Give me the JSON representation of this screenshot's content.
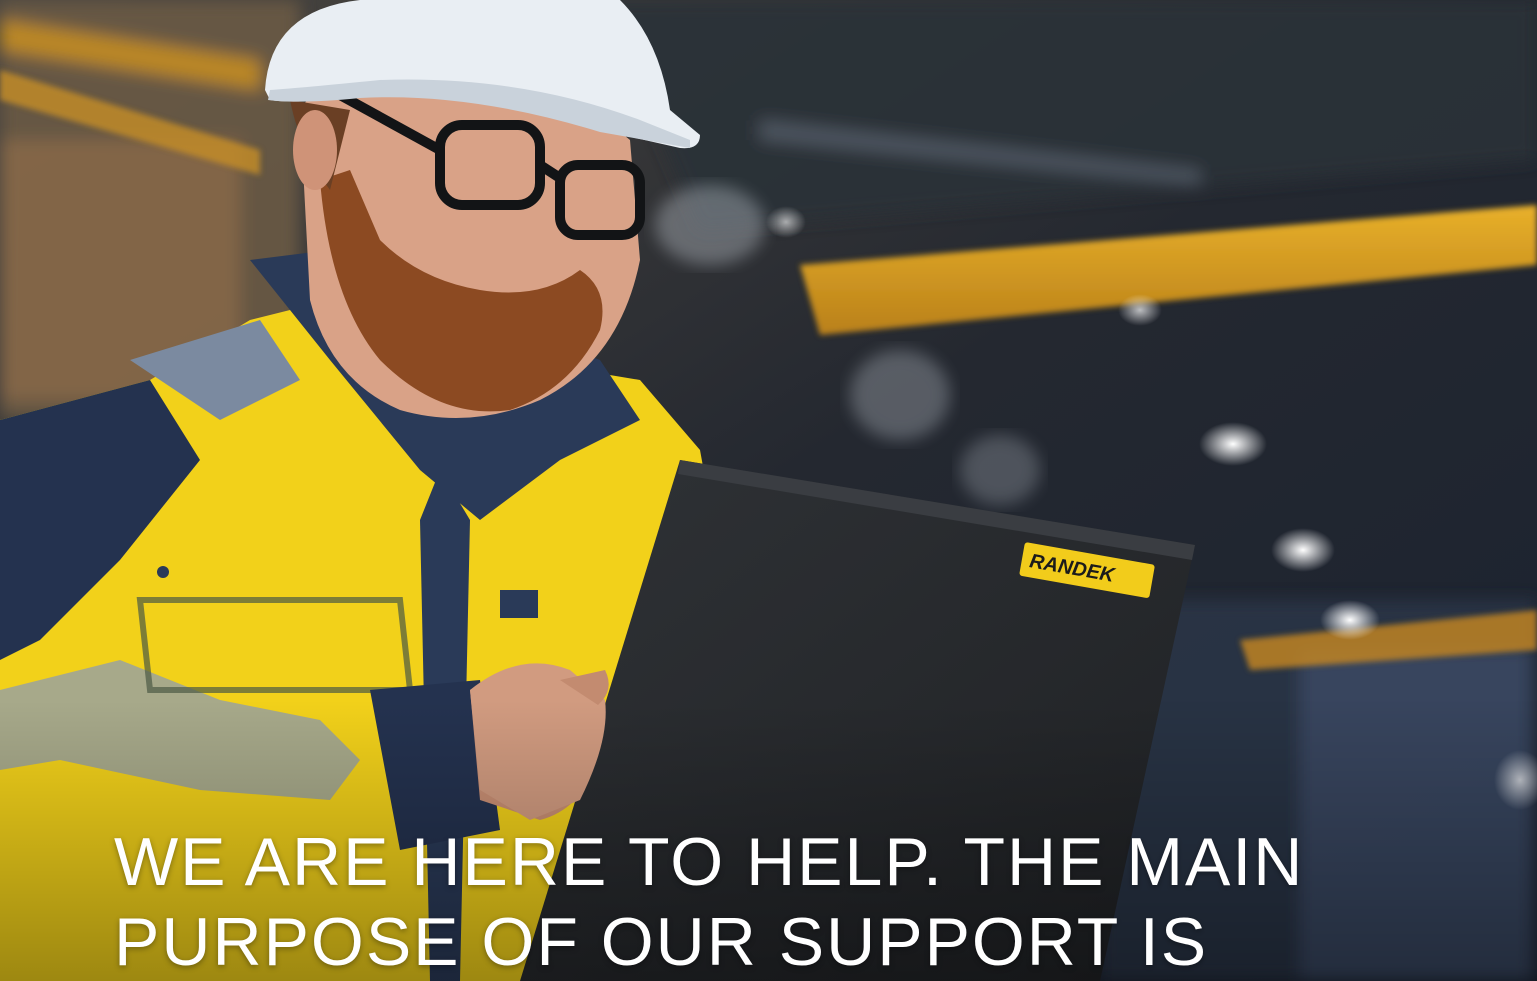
{
  "hero": {
    "image_alt": "Engineer in hard hat and high-visibility jacket using a laptop in an industrial hall",
    "laptop_logo": "RANDEK",
    "headline_line1": "WE ARE HERE TO HELP. THE MAIN",
    "headline_line2": "PURPOSE OF OUR SUPPORT IS",
    "colors": {
      "jacket_yellow": "#f2d11a",
      "jacket_navy": "#24324f",
      "crane_beam": "#d89b1e",
      "helmet": "#e9eef3",
      "laptop": "#2a2d31",
      "beard": "#8c4a22"
    }
  }
}
